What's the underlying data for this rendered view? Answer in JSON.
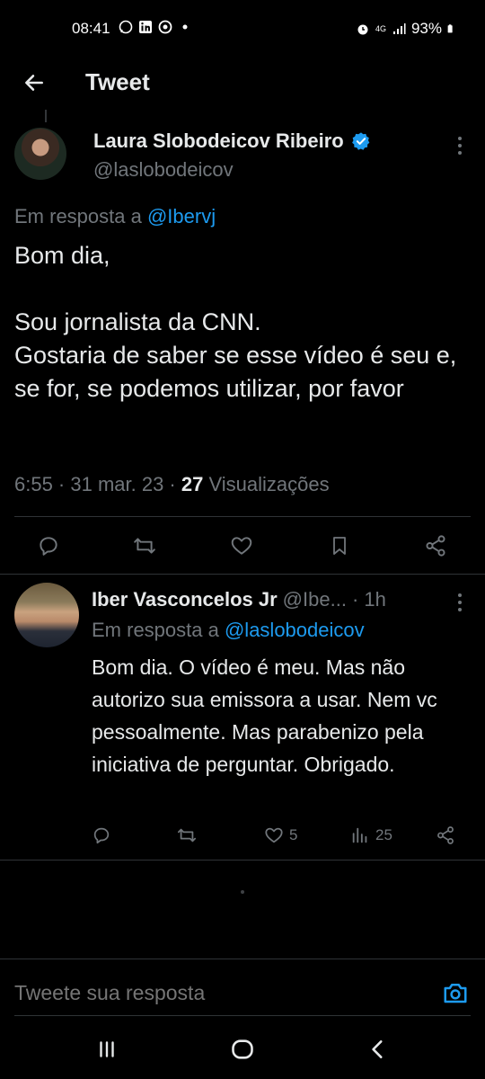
{
  "status_bar": {
    "time": "08:41",
    "network": "4G",
    "battery": "93%",
    "left_icons": [
      "whatsapp-icon",
      "linkedin-icon",
      "chrome-icon",
      "dot-icon"
    ],
    "right_icons": [
      "alarm-icon",
      "network-icon",
      "signal-icon",
      "battery-icon"
    ]
  },
  "header": {
    "back_icon": "arrow-left-icon",
    "title": "Tweet"
  },
  "main_tweet": {
    "author_name": "Laura Slobodeicov Ribeiro",
    "verified": true,
    "handle": "@laslobodeicov",
    "reply_prefix": "Em resposta a",
    "reply_to": "@Ibervj",
    "text": "Bom dia,\n\nSou jornalista da CNN.\nGostaria de saber se esse vídeo é seu e, se for, se podemos utilizar, por favor",
    "time": "6:55 · 31 mar. 23 ·",
    "views_count": "27",
    "views_label": "Visualizações",
    "actions": [
      "reply-icon",
      "retweet-icon",
      "like-icon",
      "bookmark-icon",
      "share-icon"
    ]
  },
  "reply_tweet": {
    "author_name": "Iber Vasconcelos Jr",
    "handle": "@Ibe...",
    "time": "· 1h",
    "reply_prefix": "Em resposta a",
    "reply_to": "@laslobodeicov",
    "text": "Bom dia. O vídeo é meu. Mas não autorizo sua emissora a usar. Nem vc pessoalmente. Mas parabenizo pela iniciativa de perguntar. Obrigado.",
    "likes": "5",
    "views": "25"
  },
  "compose": {
    "placeholder": "Tweete sua resposta"
  },
  "colors": {
    "background": "#000000",
    "text": "#e7e9ea",
    "muted": "#71767b",
    "accent": "#1d9bf0",
    "divider": "#2f3336"
  }
}
